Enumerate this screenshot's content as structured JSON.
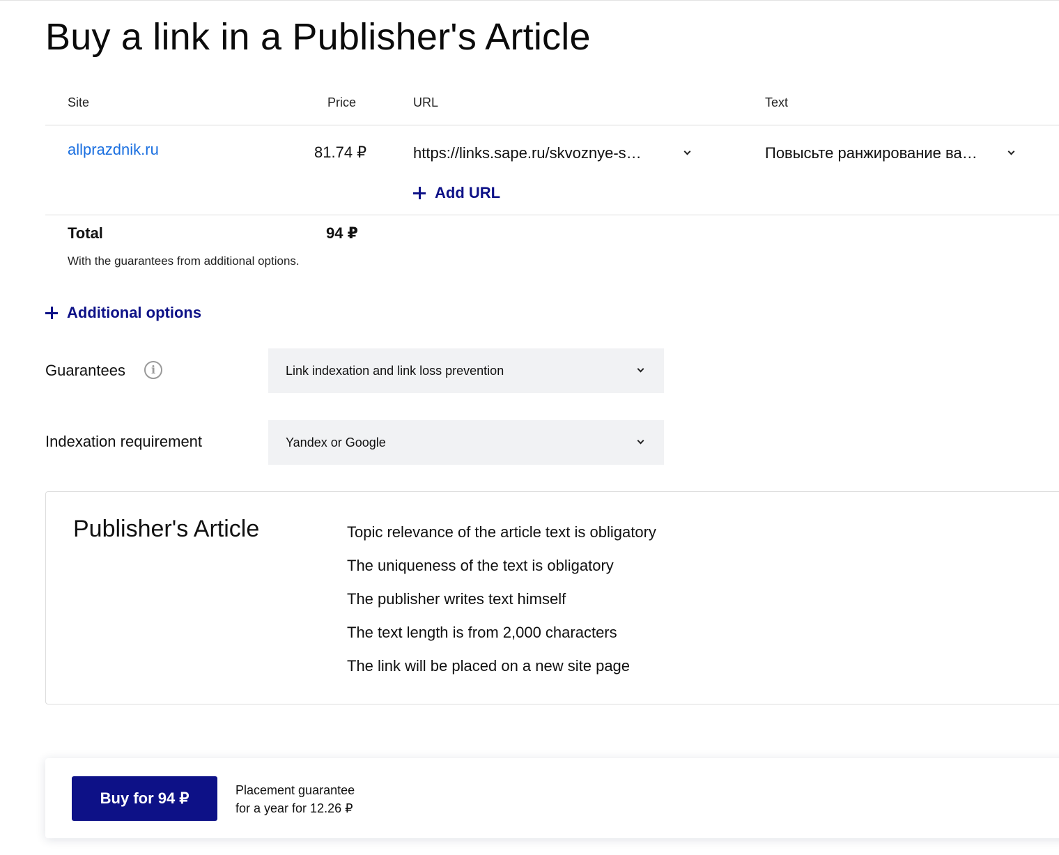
{
  "page_title": "Buy a link in a Publisher's Article",
  "table": {
    "headers": {
      "site": "Site",
      "price": "Price",
      "url": "URL",
      "text": "Text"
    },
    "row": {
      "site": "allprazdnik.ru",
      "price": "81.74 ₽",
      "url_value": "https://links.sape.ru/skvoznye-s…",
      "text_value": "Повысьте ранжирование ва…"
    },
    "add_url_label": "Add URL"
  },
  "total": {
    "label": "Total",
    "value": "94 ₽",
    "note": "With the guarantees from additional options."
  },
  "additional_options_label": "Additional options",
  "guarantees": {
    "label": "Guarantees",
    "selected": "Link indexation and link loss prevention",
    "info_icon": "info-icon"
  },
  "indexation": {
    "label": "Indexation requirement",
    "selected": "Yandex or Google"
  },
  "article_panel": {
    "title": "Publisher's Article",
    "items": [
      "Topic relevance of the article text is obligatory",
      "The uniqueness of the text is obligatory",
      "The publisher writes text himself",
      "The text length is from 2,000 characters",
      "The link will be placed on a new site page"
    ]
  },
  "footer": {
    "buy_label": "Buy for 94 ₽",
    "guarantee_line1": "Placement guarantee",
    "guarantee_line2": "for a year for 12.26 ₽"
  },
  "colors": {
    "accent": "#0d1187",
    "link": "#1a6fe0",
    "select_bg": "#f1f2f4"
  }
}
